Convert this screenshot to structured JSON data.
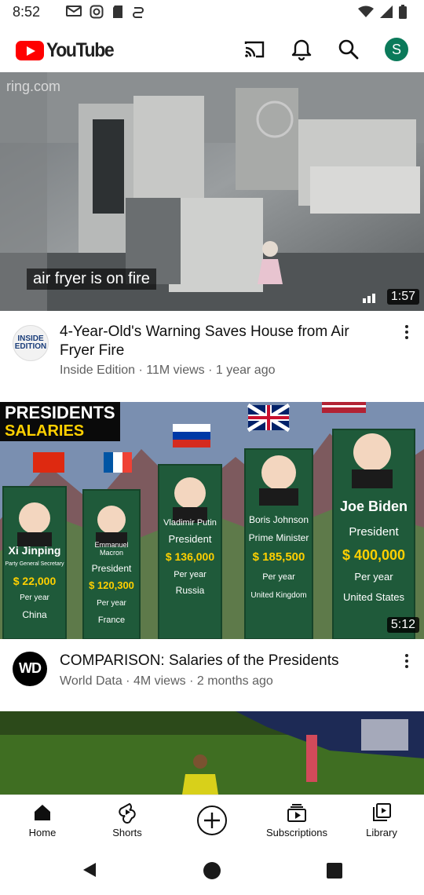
{
  "status_bar": {
    "time": "8:52"
  },
  "app_bar": {
    "logo_text": "YouTube",
    "avatar_letter": "S",
    "brand_color": "#ff0000"
  },
  "videos": [
    {
      "overlay_caption": "air fryer is on fire",
      "watermark": "ring.com",
      "duration": "1:57",
      "title": "4-Year-Old's Warning Saves House from Air Fryer Fire",
      "subtitle": "Inside Edition · 11M views · 1 year ago",
      "channel_avatar_text": "INSIDE EDITION"
    },
    {
      "duration": "5:12",
      "title": "COMPARISON: Salaries of the Presidents",
      "subtitle": "World Data · 4M views · 2 months ago",
      "channel_avatar_text": "WD",
      "thumb_text": {
        "header1": "PRESIDENTS",
        "header2": "SALARIES",
        "pillars": [
          {
            "name": "Xi Jinping",
            "role": "Party General Secretary",
            "amount": "$ 22,000",
            "per": "Per year",
            "country": "China"
          },
          {
            "name": "Emmanuel Macron",
            "role": "President",
            "amount": "$ 120,300",
            "per": "Per year",
            "country": "France"
          },
          {
            "name": "Vladimir Putin",
            "role": "President",
            "amount": "$ 136,000",
            "per": "Per year",
            "country": "Russia"
          },
          {
            "name": "Boris Johnson",
            "role": "Prime Minister",
            "amount": "$ 185,500",
            "per": "Per year",
            "country": "United Kingdom"
          },
          {
            "name": "Joe Biden",
            "role": "President",
            "amount": "$ 400,000",
            "per": "Per year",
            "country": "United States"
          }
        ]
      }
    }
  ],
  "bottom_nav": [
    {
      "label": "Home",
      "icon": "home-icon"
    },
    {
      "label": "Shorts",
      "icon": "shorts-icon"
    },
    {
      "label": "",
      "icon": "create-icon"
    },
    {
      "label": "Subscriptions",
      "icon": "subscriptions-icon"
    },
    {
      "label": "Library",
      "icon": "library-icon"
    }
  ]
}
